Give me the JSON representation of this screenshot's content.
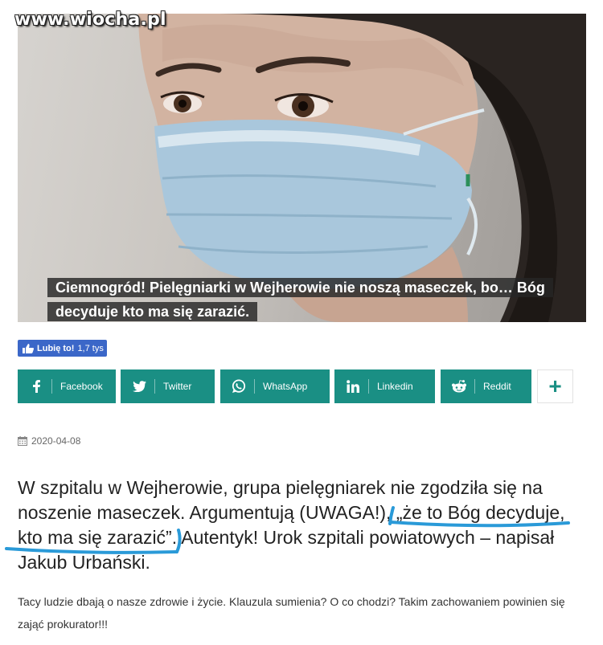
{
  "site": {
    "watermark": "www.wiocha.pl"
  },
  "hero": {
    "caption": "Ciemnogród! Pielęgniarki w Wejherowie nie noszą maseczek, bo… Bóg decyduje kto ma się zarazić."
  },
  "like": {
    "label": "Lubię to!",
    "count": "1,7 tys"
  },
  "share": {
    "buttons": [
      {
        "label": "Facebook",
        "icon": "facebook-icon"
      },
      {
        "label": "Twitter",
        "icon": "twitter-icon"
      },
      {
        "label": "WhatsApp",
        "icon": "whatsapp-icon"
      },
      {
        "label": "Linkedin",
        "icon": "linkedin-icon"
      },
      {
        "label": "Reddit",
        "icon": "reddit-icon"
      }
    ],
    "more_label": "+"
  },
  "article": {
    "date": "2020-04-08",
    "lead_part1": "W szpitalu w Wejherowie, grupa pielęgniarek nie zgodziła się na noszenie maseczek. Argumentują (UWAGA!), ",
    "lead_quote": "„że to Bóg decyduje, kto ma się zarazić”",
    "lead_part2": ". Autentyk! Urok szpitali powiatowych – napisał Jakub Urbański.",
    "body": "Tacy ludzie dbają o nasze zdrowie i życie. Klauzula sumienia? O co chodzi? Takim zachowaniem powinien się zająć prokurator!!!"
  },
  "colors": {
    "share_bg": "#1a8f84",
    "like_bg": "#3b67c8",
    "annotation": "#2a9ad8"
  }
}
